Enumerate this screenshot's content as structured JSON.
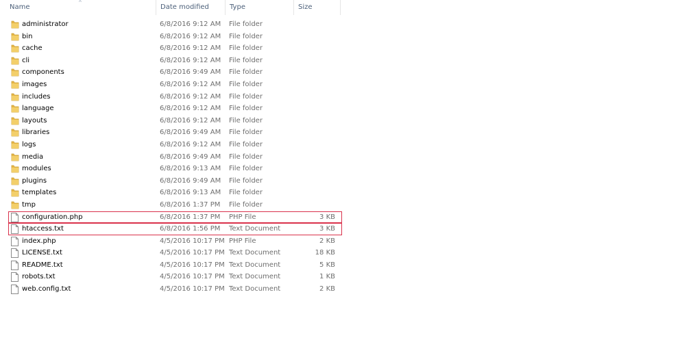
{
  "columns": {
    "name": "Name",
    "date_modified": "Date modified",
    "type": "Type",
    "size": "Size"
  },
  "sort": {
    "column": "name",
    "indicator": "^"
  },
  "accent_highlight": "#d9304a",
  "icons": {
    "folder": "folder-icon",
    "file": "file-icon"
  },
  "items": [
    {
      "name": "administrator",
      "date": "6/8/2016 9:12 AM",
      "type": "File folder",
      "size": "",
      "kind": "folder"
    },
    {
      "name": "bin",
      "date": "6/8/2016 9:12 AM",
      "type": "File folder",
      "size": "",
      "kind": "folder"
    },
    {
      "name": "cache",
      "date": "6/8/2016 9:12 AM",
      "type": "File folder",
      "size": "",
      "kind": "folder"
    },
    {
      "name": "cli",
      "date": "6/8/2016 9:12 AM",
      "type": "File folder",
      "size": "",
      "kind": "folder"
    },
    {
      "name": "components",
      "date": "6/8/2016 9:49 AM",
      "type": "File folder",
      "size": "",
      "kind": "folder"
    },
    {
      "name": "images",
      "date": "6/8/2016 9:12 AM",
      "type": "File folder",
      "size": "",
      "kind": "folder"
    },
    {
      "name": "includes",
      "date": "6/8/2016 9:12 AM",
      "type": "File folder",
      "size": "",
      "kind": "folder"
    },
    {
      "name": "language",
      "date": "6/8/2016 9:12 AM",
      "type": "File folder",
      "size": "",
      "kind": "folder"
    },
    {
      "name": "layouts",
      "date": "6/8/2016 9:12 AM",
      "type": "File folder",
      "size": "",
      "kind": "folder"
    },
    {
      "name": "libraries",
      "date": "6/8/2016 9:49 AM",
      "type": "File folder",
      "size": "",
      "kind": "folder"
    },
    {
      "name": "logs",
      "date": "6/8/2016 9:12 AM",
      "type": "File folder",
      "size": "",
      "kind": "folder"
    },
    {
      "name": "media",
      "date": "6/8/2016 9:49 AM",
      "type": "File folder",
      "size": "",
      "kind": "folder"
    },
    {
      "name": "modules",
      "date": "6/8/2016 9:13 AM",
      "type": "File folder",
      "size": "",
      "kind": "folder"
    },
    {
      "name": "plugins",
      "date": "6/8/2016 9:49 AM",
      "type": "File folder",
      "size": "",
      "kind": "folder"
    },
    {
      "name": "templates",
      "date": "6/8/2016 9:13 AM",
      "type": "File folder",
      "size": "",
      "kind": "folder"
    },
    {
      "name": "tmp",
      "date": "6/8/2016 1:37 PM",
      "type": "File folder",
      "size": "",
      "kind": "folder"
    },
    {
      "name": "configuration.php",
      "date": "6/8/2016 1:37 PM",
      "type": "PHP File",
      "size": "3 KB",
      "kind": "file",
      "highlighted": true
    },
    {
      "name": "htaccess.txt",
      "date": "6/8/2016 1:56 PM",
      "type": "Text Document",
      "size": "3 KB",
      "kind": "file",
      "highlighted": true
    },
    {
      "name": "index.php",
      "date": "4/5/2016 10:17 PM",
      "type": "PHP File",
      "size": "2 KB",
      "kind": "file"
    },
    {
      "name": "LICENSE.txt",
      "date": "4/5/2016 10:17 PM",
      "type": "Text Document",
      "size": "18 KB",
      "kind": "file"
    },
    {
      "name": "README.txt",
      "date": "4/5/2016 10:17 PM",
      "type": "Text Document",
      "size": "5 KB",
      "kind": "file"
    },
    {
      "name": "robots.txt",
      "date": "4/5/2016 10:17 PM",
      "type": "Text Document",
      "size": "1 KB",
      "kind": "file"
    },
    {
      "name": "web.config.txt",
      "date": "4/5/2016 10:17 PM",
      "type": "Text Document",
      "size": "2 KB",
      "kind": "file"
    }
  ]
}
